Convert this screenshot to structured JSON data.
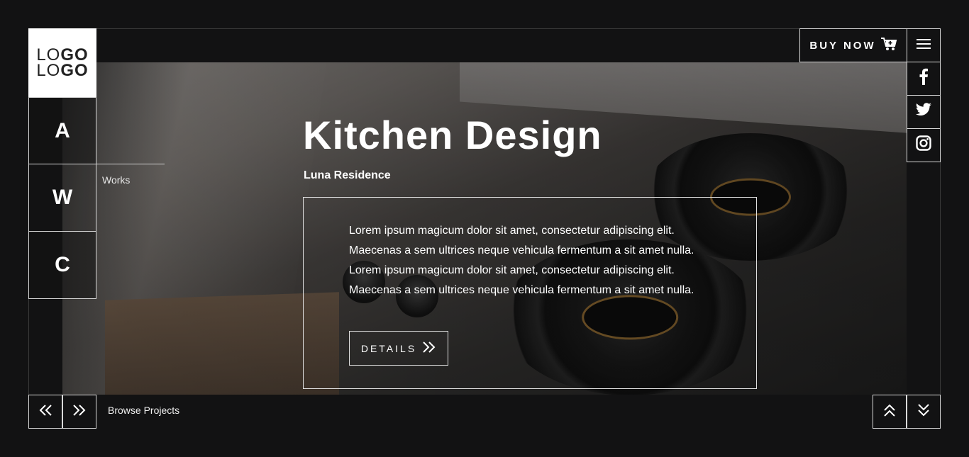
{
  "logo": {
    "line1_light": "LO",
    "line1_bold": "GO",
    "line2_light": "LO",
    "line2_bold": "GO"
  },
  "left_nav": {
    "items": [
      {
        "label": "A"
      },
      {
        "label": "W"
      },
      {
        "label": "C"
      }
    ],
    "hover_label": "Works"
  },
  "header": {
    "buy_now_label": "BUY NOW"
  },
  "social": [
    "facebook",
    "twitter",
    "instagram"
  ],
  "hero": {
    "title": "Kitchen Design",
    "subtitle": "Luna Residence",
    "description": "Lorem ipsum magicum dolor sit amet, consectetur adipiscing elit. Maecenas a sem ultrices neque vehicula fermentum a sit amet nulla. Lorem ipsum magicum dolor sit amet, consectetur adipiscing elit. Maecenas a sem ultrices neque vehicula fermentum a sit amet nulla.",
    "details_label": "DETAILS"
  },
  "footer": {
    "browse_label": "Browse Projects"
  },
  "colors": {
    "background": "#121213",
    "text": "#ffffff",
    "border": "#d9d9d9"
  }
}
